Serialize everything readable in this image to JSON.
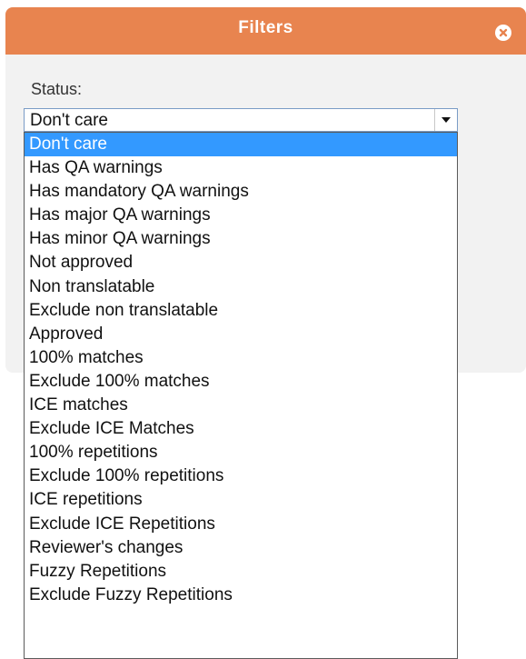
{
  "dialog": {
    "title": "Filters",
    "close_icon": "close-circle-x-icon",
    "header_color": "#e8844f"
  },
  "status": {
    "label": "Status:",
    "selected": "Don't care",
    "arrow_icon": "dropdown-arrow-icon"
  },
  "options": [
    {
      "label": "Don't care",
      "selected": true
    },
    {
      "label": "Has QA warnings",
      "selected": false
    },
    {
      "label": "Has mandatory QA warnings",
      "selected": false
    },
    {
      "label": "Has major QA warnings",
      "selected": false
    },
    {
      "label": "Has minor QA warnings",
      "selected": false
    },
    {
      "label": "Not approved",
      "selected": false
    },
    {
      "label": "Non translatable",
      "selected": false
    },
    {
      "label": "Exclude non translatable",
      "selected": false
    },
    {
      "label": "Approved",
      "selected": false
    },
    {
      "label": "100% matches",
      "selected": false
    },
    {
      "label": "Exclude 100% matches",
      "selected": false
    },
    {
      "label": "ICE matches",
      "selected": false
    },
    {
      "label": "Exclude ICE Matches",
      "selected": false
    },
    {
      "label": "100% repetitions",
      "selected": false
    },
    {
      "label": "Exclude 100% repetitions",
      "selected": false
    },
    {
      "label": "ICE repetitions",
      "selected": false
    },
    {
      "label": "Exclude ICE Repetitions",
      "selected": false
    },
    {
      "label": "Reviewer's changes",
      "selected": false
    },
    {
      "label": "Fuzzy Repetitions",
      "selected": false
    },
    {
      "label": "Exclude Fuzzy Repetitions",
      "selected": false
    }
  ],
  "colors": {
    "selection_highlight": "#3399ff"
  }
}
